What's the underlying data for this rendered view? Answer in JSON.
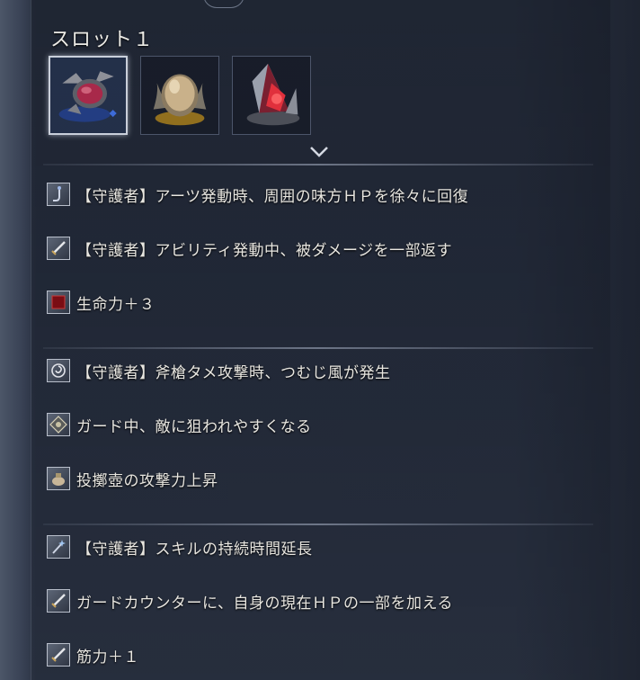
{
  "slot": {
    "title": "スロット１",
    "gems": [
      {
        "name": "ruby-brooch",
        "color": "#b23a5a",
        "selected": true
      },
      {
        "name": "amber-orb",
        "color": "#c9a35a",
        "selected": false
      },
      {
        "name": "crimson-crystal",
        "color": "#d2303a",
        "selected": false
      }
    ]
  },
  "groups": [
    {
      "effects": [
        {
          "icon": "rod-icon",
          "text": "【守護者】アーツ発動時、周囲の味方ＨＰを徐々に回復"
        },
        {
          "icon": "sword-icon",
          "text": "【守護者】アビリティ発動中、被ダメージを一部返す"
        },
        {
          "icon": "red-book-icon",
          "text": "生命力＋３"
        }
      ]
    },
    {
      "effects": [
        {
          "icon": "spiral-icon",
          "text": "【守護者】斧槍タメ攻撃時、つむじ風が発生"
        },
        {
          "icon": "diamond-emblem-icon",
          "text": "ガード中、敵に狙われやすくなる"
        },
        {
          "icon": "pot-icon",
          "text": "投擲壺の攻撃力上昇"
        }
      ]
    },
    {
      "effects": [
        {
          "icon": "sparkle-wand-icon",
          "text": "【守護者】スキルの持続時間延長"
        },
        {
          "icon": "sword-icon",
          "text": "ガードカウンターに、自身の現在ＨＰの一部を加える"
        },
        {
          "icon": "sword-icon",
          "text": "筋力＋１"
        }
      ]
    }
  ],
  "colors": {
    "background": "#283041",
    "text": "#e8e6e0",
    "selected_border": "#c9cfda"
  }
}
